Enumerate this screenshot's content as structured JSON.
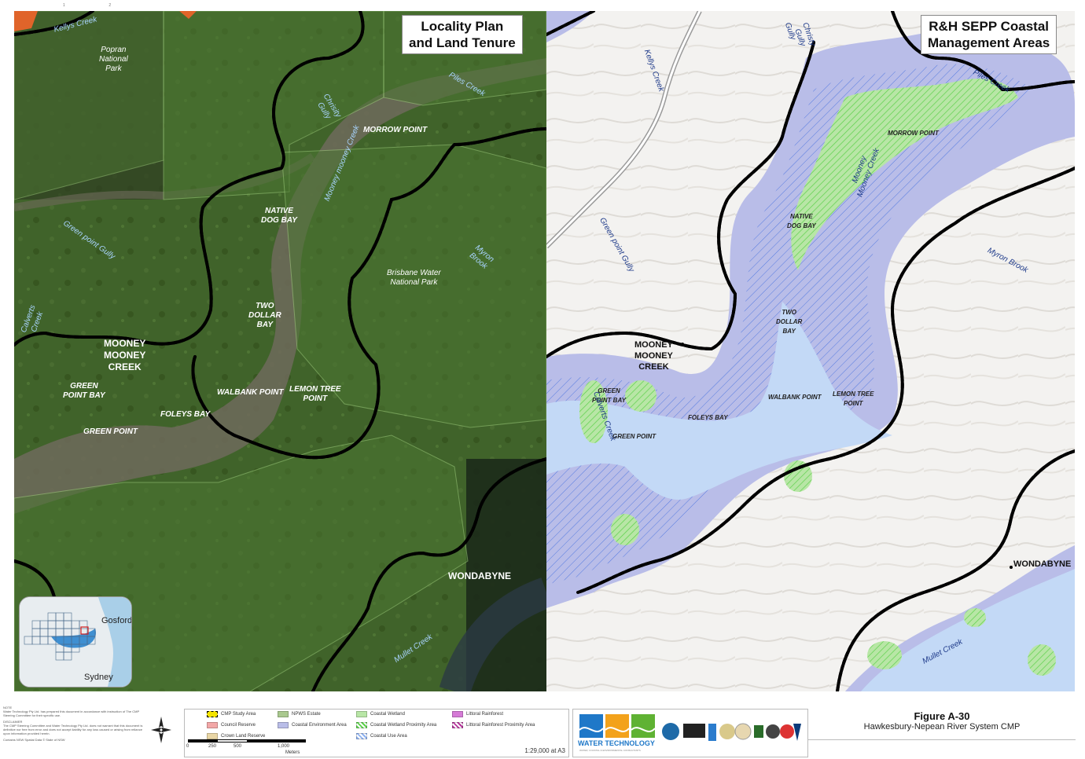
{
  "left_panel": {
    "title_line1": "Locality Plan",
    "title_line2": "and Land Tenure",
    "labels": {
      "kellys_creek": "Kellys Creek",
      "popran": "Popran\nNational\nPark",
      "chrisity_gully": "Chrisity\nGully",
      "piles_creek": "Piles Creek",
      "morrow_point": "MORROW POINT",
      "mooney_mooney_creek": "Mooney mooney Creek",
      "native_dog_bay": "NATIVE\nDOG BAY",
      "green_point_gully": "Green point Gully",
      "myron_brook": "Myron\nBrook",
      "brisbane_water_np": "Brisbane Water\nNational Park",
      "two_dollar_bay": "TWO\nDOLLAR\nBAY",
      "calverts_creek": "Calverts\nCreek",
      "mooney_mooney_creek_town": "MOONEY\nMOONEY\nCREEK",
      "green_point_bay": "GREEN\nPOINT BAY",
      "walbank_point": "WALBANK POINT",
      "lemon_tree_point": "LEMON TREE\nPOINT",
      "foleys_bay": "FOLEYS BAY",
      "green_point": "GREEN POINT",
      "wondabyne": "WONDABYNE",
      "mullet_creek": "Mullet Creek"
    },
    "inset": {
      "gosford": "Gosford",
      "sydney": "Sydney"
    }
  },
  "right_panel": {
    "title_line1": "R&H SEPP Coastal",
    "title_line2": "Management Areas",
    "labels": {
      "kellys_creek": "Kellys Creek",
      "gully": "Gully",
      "chrisity_gully": "Christy\nGully",
      "piles_creek": "Piles Creek",
      "morrow_point": "MORROW POINT",
      "mooney_mooney_creek": "Mooney\nMooney Creek",
      "native_dog_bay": "NATIVE\nDOG BAY",
      "green_point_gully": "Green point Gully",
      "myron_brook": "Myron Brook",
      "two_dollar_bay": "TWO\nDOLLAR\nBAY",
      "mooney_mooney_creek_town": "MOONEY\nMOONEY\nCREEK",
      "green_point_bay": "GREEN\nPOINT BAY",
      "calverts_creek": "Calverts Creek",
      "walbank_point": "WALBANK POINT",
      "lemon_tree_point": "LEMON TREE\nPOINT",
      "foleys_bay": "FOLEYS BAY",
      "green_point": "GREEN POINT",
      "wondabyne": "WONDABYNE",
      "mullet_creek": "Mullet Creek"
    }
  },
  "legend": {
    "items": [
      {
        "label": "CMP Study Area",
        "color": "#f5e400"
      },
      {
        "label": "Council Reserve",
        "color": "#f2a7a7"
      },
      {
        "label": "Crown Land Reserve",
        "color": "#e9d6a5"
      },
      {
        "label": "NPWS Estate",
        "color": "#a9c88e"
      },
      {
        "label": "Coastal Environment Area",
        "color": "#b9bde8"
      },
      {
        "label": "Coastal Wetland",
        "color": "#b8e6a6"
      },
      {
        "label": "Coastal Wetland Proximity Area",
        "color": "#5bd14a"
      },
      {
        "label": "Coastal Use Area",
        "color": "#8fb2f0"
      },
      {
        "label": "Littoral Rainforest",
        "color": "#d57bd6"
      },
      {
        "label": "Littoral Rainforest Proximity Area",
        "color": "#b5369b"
      }
    ],
    "scale_ticks": [
      "0",
      "250",
      "500",
      "1,000"
    ],
    "scale_unit": "Meters",
    "scale_ratio": "1:29,000 at A3"
  },
  "notes": {
    "note_heading": "NOTE",
    "note_text": "Water Technology Pty Ltd. has prepared this document in accordance with instruction of The CMP Steering Committee for their specific use.",
    "disclaimer_heading": "DISCLAIMER",
    "disclaimer_text": "The CMP Steering Committee and Water Technology Pty Ltd. does not warrant that this document is definitive nor free from error and does not accept liability for any loss caused or arising from reliance upon information provided herein.",
    "contains": "Contains NSW Spatial Data © State of NSW"
  },
  "logo": {
    "name": "WATER TECHNOLOGY",
    "tagline": "WATER, COASTAL & ENVIRONMENTAL CONSULTANTS"
  },
  "figure": {
    "number": "Figure A-30",
    "subtitle": "Hawkesbury-Nepean River System CMP"
  },
  "colors": {
    "study_boundary": "#f5e400",
    "npws": "#3f5e22",
    "environment_area": "#b9bde8",
    "use_area": "#8fb2f0",
    "wetland": "#5bd14a"
  }
}
